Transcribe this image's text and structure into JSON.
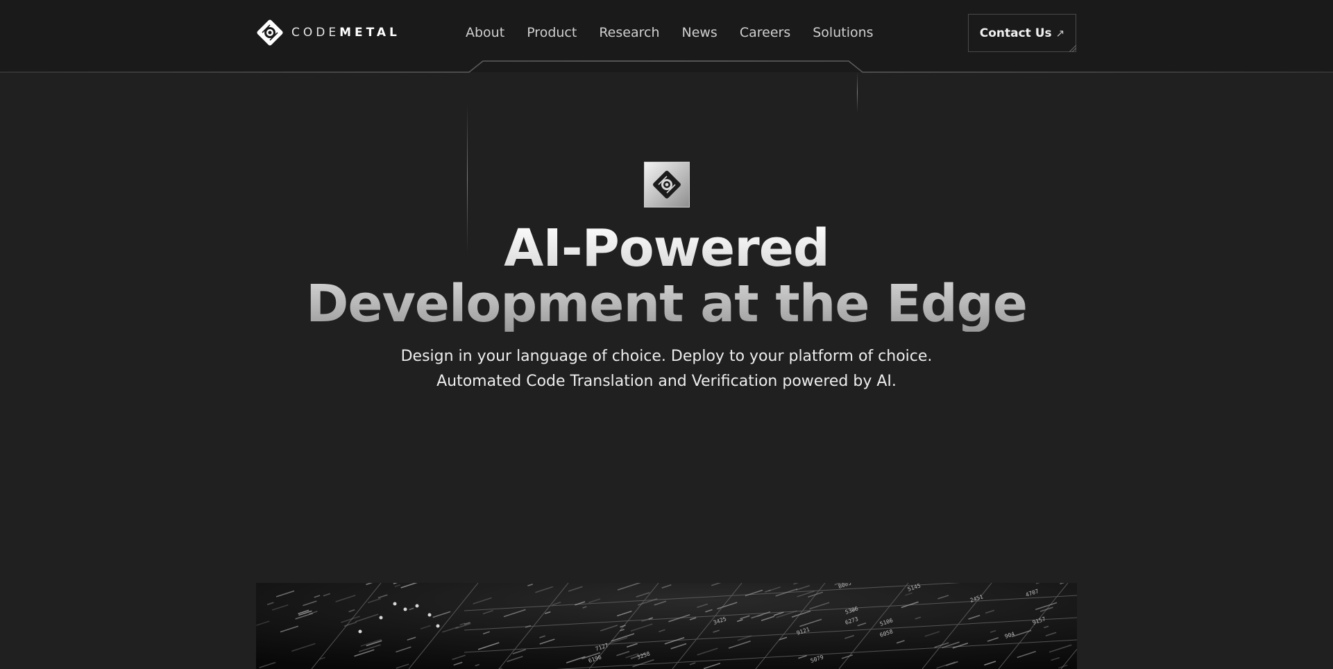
{
  "brand": {
    "name_light": "CODE",
    "name_bold": "METAL"
  },
  "nav": {
    "items": [
      {
        "label": "About"
      },
      {
        "label": "Product"
      },
      {
        "label": "Research"
      },
      {
        "label": "News"
      },
      {
        "label": "Careers"
      },
      {
        "label": "Solutions"
      }
    ]
  },
  "header": {
    "contact_label": "Contact Us",
    "contact_icon": "arrow-up-right-icon"
  },
  "hero": {
    "badge_icon": "codemetal-logo-icon",
    "title_line1": "AI-Powered",
    "title_line2": "Development at the Edge",
    "subtitle_line1": "Design in your language of choice. Deploy to your platform of choice.",
    "subtitle_line2": "Automated Code Translation and Verification powered by AI."
  },
  "feature_image": {
    "icon": "circuit-data-grid-image",
    "labels": [
      "8005",
      "5145",
      "3425",
      "4707",
      "5306",
      "6273",
      "9121",
      "5106",
      "6058",
      "904",
      "9157",
      "7127",
      "3258",
      "5079",
      "6196",
      "2451"
    ]
  },
  "colors": {
    "background": "#202020",
    "header_background": "#1a1a1a",
    "text_primary": "#eeeeee",
    "nav_text": "#d0d0d0",
    "border": "#4a4a4a"
  }
}
